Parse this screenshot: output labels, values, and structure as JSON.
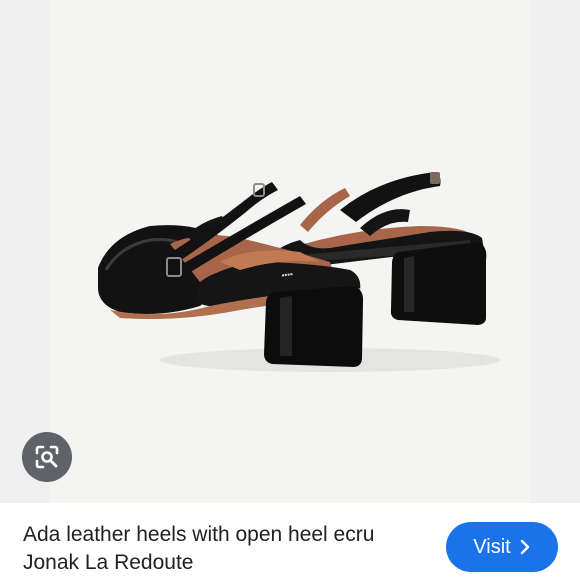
{
  "image": {
    "icon": "product-photo-shoes"
  },
  "lens": {
    "icon": "lens-search-icon"
  },
  "result": {
    "title_line1": "Ada leather heels with open heel ecru",
    "title_line2": "Jonak La Redoute"
  },
  "visit": {
    "label": "Visit",
    "icon": "chevron-right-icon"
  },
  "colors": {
    "accent": "#1a73e8",
    "lens_bg": "#5f6368",
    "photo_bg": "#f4f4f3",
    "shoe_black": "#111111",
    "lining_tan": "#a8654a"
  }
}
